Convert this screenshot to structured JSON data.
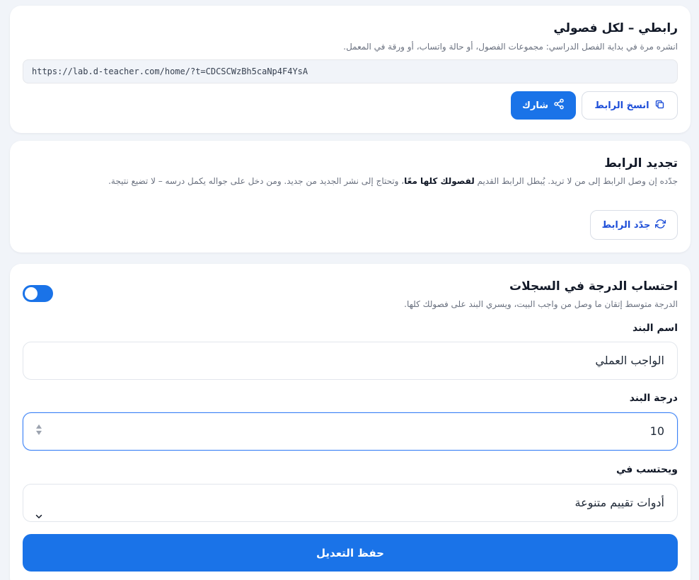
{
  "share_link": {
    "title": "رابطي – لكل فصولي",
    "description": "انشره مرة في بداية الفصل الدراسي: مجموعات الفصول، أو حالة واتساب، أو ورقة في المعمل.",
    "url": "https://lab.d-teacher.com/home/?t=CDCSCWzBh5caNp4F4YsA",
    "copy_label": "انسخ الرابط",
    "copy_icon": "copy-icon",
    "share_label": "شارك",
    "share_icon": "share-icon"
  },
  "renew_link": {
    "title": "تجديد الرابط",
    "description_before": "جدّده إن وصل الرابط إلى من لا تريد. يُبطل الرابط القديم ",
    "description_bold": "لفصولك كلها معًا",
    "description_after": "، وتحتاج إلى نشر الجديد من جديد. ومن دخل على جواله يكمل درسه – لا تضيع نتيجة.",
    "renew_label": "جدّد الرابط",
    "renew_icon": "refresh-icon"
  },
  "grade_settings": {
    "title": "احتساب الدرجة في السجلات",
    "description": "الدرجة متوسط إتقان ما وصل من واجب البيت، ويسري البند على فصولك كلها.",
    "toggle_on": true,
    "item_name_label": "اسم البند",
    "item_name_value": "الواجب العملي",
    "item_grade_label": "درجة البند",
    "item_grade_value": "10",
    "counted_in_label": "ويحتسب في",
    "counted_in_value": "أدوات تقييم متنوعة",
    "save_label": "حفظ التعديل"
  },
  "colors": {
    "primary": "#1a73e8",
    "background": "#f1f4f9",
    "card": "#ffffff"
  }
}
